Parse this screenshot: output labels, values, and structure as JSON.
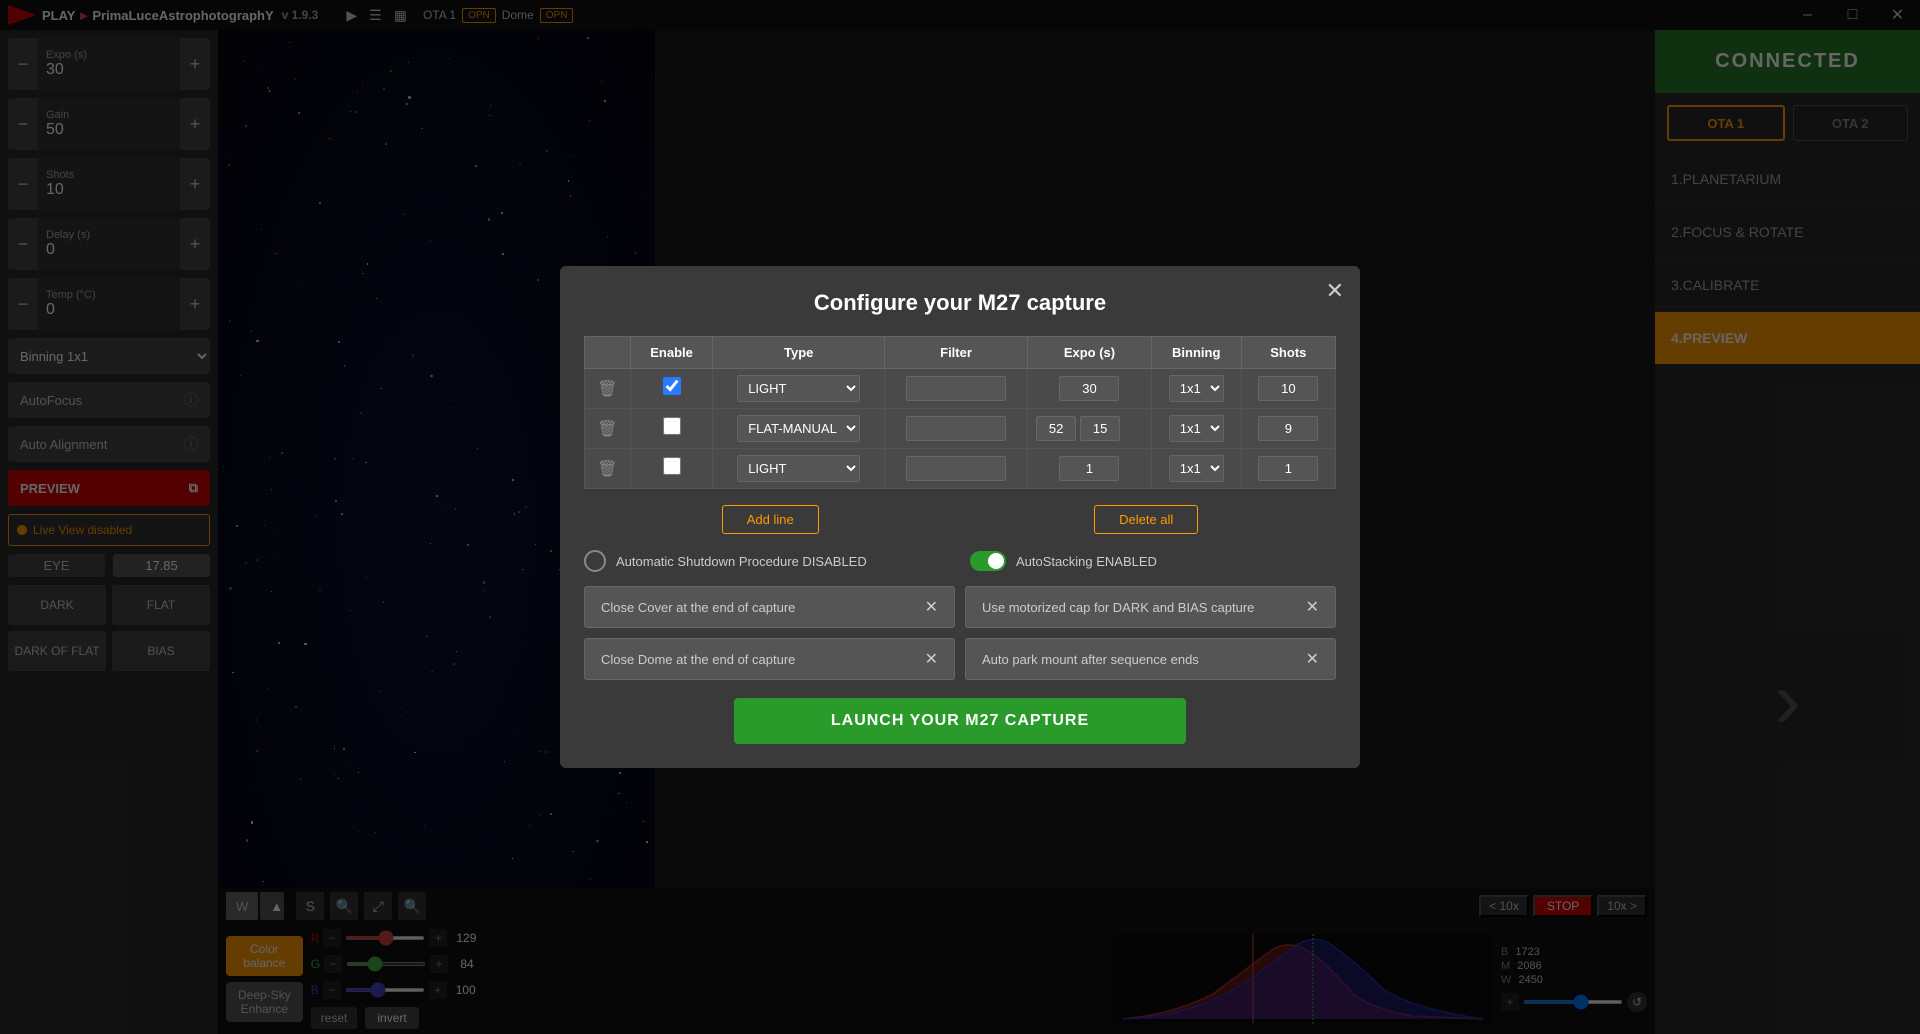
{
  "app": {
    "name": "PrimaLuceAstrophotographY",
    "version": "v 1.9.3",
    "title": "PLAY"
  },
  "titlebar": {
    "ota_label": "OTA 1",
    "ota_badge": "OPN",
    "dome_label": "Dome",
    "dome_badge": "OPN",
    "minimize": "–",
    "maximize": "□",
    "close": "✕"
  },
  "left_sidebar": {
    "expo_label": "Expo (s)",
    "expo_value": "30",
    "gain_label": "Gain",
    "gain_value": "50",
    "shots_label": "Shots",
    "shots_value": "10",
    "delay_label": "Delay (s)",
    "delay_value": "0",
    "temp_label": "Temp (°C)",
    "temp_value": "0",
    "binning_label": "Binning 1x1",
    "autofocus_label": "AutoFocus",
    "auto_alignment_label": "Auto Alignment",
    "preview_label": "PREVIEW",
    "live_view_label": "Live View disabled",
    "eye_label": "EYE",
    "eye_value": "17.85",
    "dark_label": "DARK",
    "flat_label": "FLAT",
    "dark_of_flat_label": "DARK OF FLAT",
    "bias_label": "BIAS"
  },
  "right_sidebar": {
    "connected": "CONNECTED",
    "ota1": "OTA 1",
    "ota2": "OTA 2",
    "nav1": "1.PLANETARIUM",
    "nav2": "2.FOCUS & ROTATE",
    "nav3": "3.CALIBRATE",
    "nav4": "4.PREVIEW"
  },
  "navbar": {
    "w": "W",
    "s": "S",
    "arrow_right": ">",
    "less10": "< 10x",
    "stop": "STOP",
    "more10": "10x >"
  },
  "histogram": {
    "r_label": "R",
    "g_label": "G",
    "b_label": "B",
    "r_value": "129",
    "g_value": "84",
    "b_value": "100",
    "minus": "-",
    "plus": "+",
    "reset": "reset",
    "invert": "invert",
    "color_balance": "Color\nbalance",
    "deep_sky": "Deep-Sky\nEnhance",
    "b_stat": "1723",
    "m_stat": "2086",
    "w_stat": "2450",
    "b_label_stat": "B",
    "m_label_stat": "M",
    "w_label_stat": "W"
  },
  "modal": {
    "title": "Configure your M27 capture",
    "table_headers": [
      "Enable",
      "Type",
      "Filter",
      "Expo (s)",
      "Binning",
      "Shots"
    ],
    "rows": [
      {
        "enabled": true,
        "type": "LIGHT",
        "filter": "",
        "expo": "30",
        "binning": "1x1",
        "shots": "10"
      },
      {
        "enabled": false,
        "type": "FLAT-MANUAL",
        "filter": "",
        "expo1": "52",
        "expo2": "15",
        "binning": "1x1",
        "shots": "9"
      },
      {
        "enabled": false,
        "type": "LIGHT",
        "filter": "",
        "expo": "1",
        "binning": "1x1",
        "shots": "1"
      }
    ],
    "add_line": "Add line",
    "delete_all": "Delete all",
    "auto_shutdown_label": "Automatic Shutdown Procedure DISABLED",
    "auto_stacking_label": "AutoStacking ENABLED",
    "close_cover": "Close Cover at the end of capture",
    "use_motorized": "Use motorized cap for DARK and BIAS capture",
    "close_dome": "Close Dome at the end of capture",
    "auto_park": "Auto park mount after sequence ends",
    "launch_btn": "LAUNCH YOUR M27 CAPTURE"
  }
}
